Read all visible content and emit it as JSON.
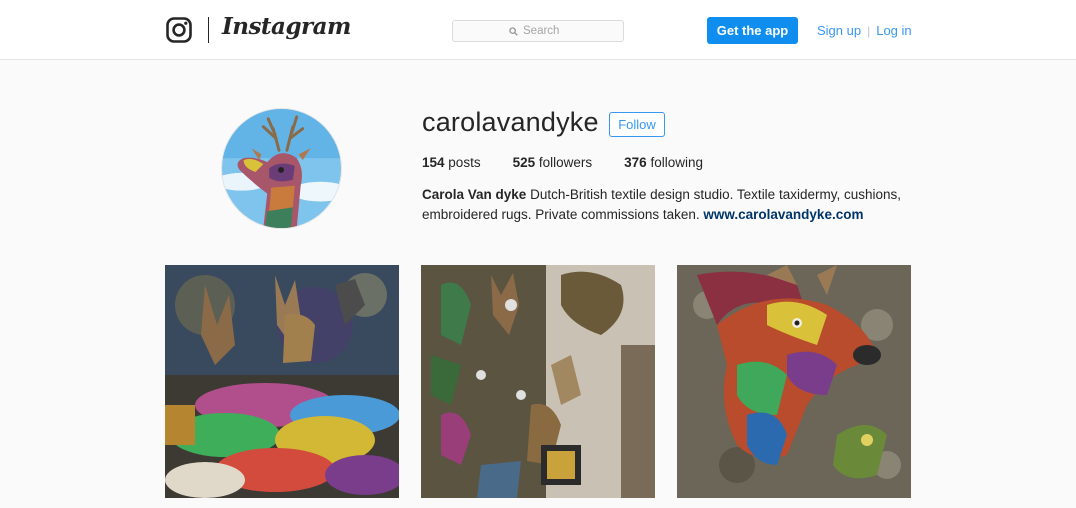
{
  "header": {
    "brand": "Instagram",
    "search_placeholder": "Search",
    "get_app_label": "Get the app",
    "signup_label": "Sign up",
    "separator": "|",
    "login_label": "Log in"
  },
  "profile": {
    "username": "carolavandyke",
    "follow_label": "Follow",
    "stats": [
      {
        "count": "154",
        "label": "posts"
      },
      {
        "count": "525",
        "label": "followers"
      },
      {
        "count": "376",
        "label": "following"
      }
    ],
    "full_name": "Carola Van dyke",
    "bio": "Dutch-British textile design studio. Textile taxidermy, cushions, embroidered rugs. Private commissions taken.",
    "website": "www.carolavandyke.com"
  },
  "posts": [
    {
      "subject": "textile deer heads and colourful cushions"
    },
    {
      "subject": "wall of textile animal heads"
    },
    {
      "subject": "close-up of a colourful textile deer head"
    }
  ],
  "colors": {
    "accent": "#3897f0",
    "primary_button": "#0f8ef0",
    "link": "#003569",
    "background": "#fafafa",
    "text": "#262626"
  },
  "icons": [
    "instagram-glyph-icon",
    "search-icon"
  ]
}
